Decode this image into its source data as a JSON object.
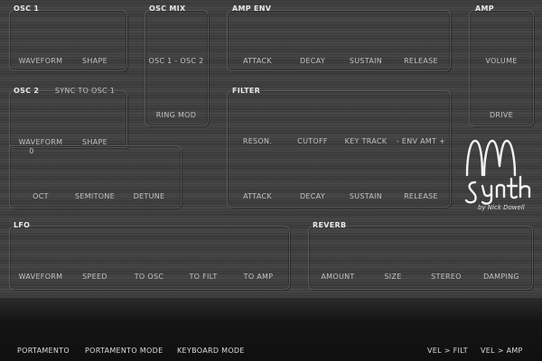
{
  "osc1": {
    "title": "OSC 1",
    "waveform": "WAVEFORM",
    "shape": "SHAPE"
  },
  "osc_mix": {
    "title": "OSC MIX",
    "mix": "OSC 1 - OSC 2",
    "ring_mod": "RING MOD"
  },
  "amp_env": {
    "title": "AMP ENV",
    "attack": "ATTACK",
    "decay": "DECAY",
    "sustain": "SUSTAIN",
    "release": "RELEASE"
  },
  "amp": {
    "title": "AMP",
    "volume": "VOLUME",
    "drive": "DRIVE"
  },
  "osc2": {
    "title": "OSC 2",
    "sync": "SYNC TO OSC 1",
    "waveform": "WAVEFORM",
    "waveform_value": "0",
    "shape": "SHAPE",
    "oct": "OCT",
    "semitone": "SEMITONE",
    "detune": "DETUNE"
  },
  "filter": {
    "title": "FILTER",
    "reson": "RESON.",
    "cutoff": "CUTOFF",
    "key_track": "KEY TRACK",
    "env_amt": "- ENV AMT +",
    "attack": "ATTACK",
    "decay": "DECAY",
    "sustain": "SUSTAIN",
    "release": "RELEASE"
  },
  "logo": {
    "credit": "by Nick Dowell"
  },
  "lfo": {
    "title": "LFO",
    "waveform": "WAVEFORM",
    "speed": "SPEED",
    "to_osc": "TO OSC",
    "to_filt": "TO FILT",
    "to_amp": "TO AMP"
  },
  "reverb": {
    "title": "REVERB",
    "amount": "AMOUNT",
    "size": "SIZE",
    "stereo": "STEREO",
    "damping": "DAMPING"
  },
  "bottom": {
    "portamento": "PORTAMENTO",
    "portamento_mode": "PORTAMENTO MODE",
    "keyboard_mode": "KEYBOARD MODE",
    "vel_filt": "VEL > FILT",
    "vel_amp": "VEL > AMP"
  }
}
